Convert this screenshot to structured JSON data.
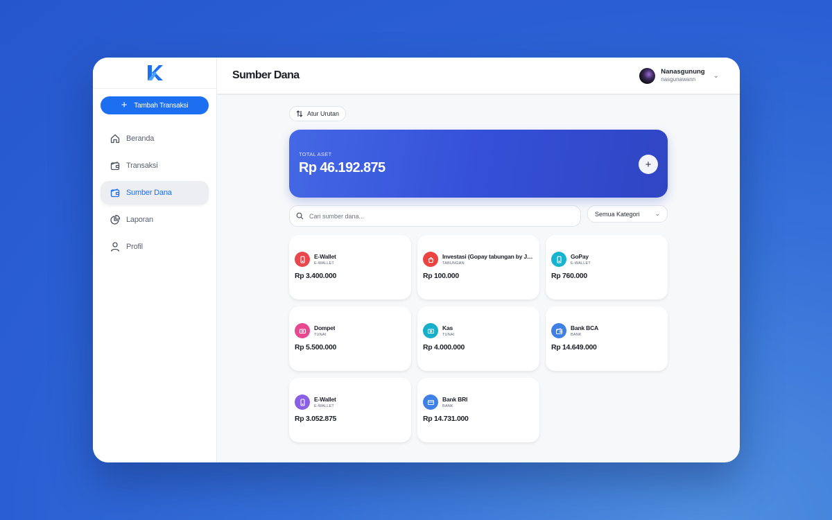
{
  "sidebar": {
    "add_button_label": "Tambah Transaksi",
    "items": [
      {
        "label": "Beranda",
        "icon": "home-icon"
      },
      {
        "label": "Transaksi",
        "icon": "wallet-icon"
      },
      {
        "label": "Sumber Dana",
        "icon": "wallet-icon",
        "active": true
      },
      {
        "label": "Laporan",
        "icon": "pie-chart-icon"
      },
      {
        "label": "Profil",
        "icon": "user-icon"
      }
    ]
  },
  "header": {
    "title": "Sumber Dana",
    "user": {
      "name": "Nanasgunung",
      "handle": "nasgunawann"
    }
  },
  "toolbar": {
    "sort_label": "Atur Urutan"
  },
  "total": {
    "label": "TOTAL ASET",
    "value": "Rp 46.192.875"
  },
  "filters": {
    "search_placeholder": "Cari sumber dana...",
    "category": "Semua Kategori"
  },
  "funds": [
    {
      "name": "E-Wallet",
      "type": "E-WALLET",
      "amount": "Rp 3.400.000",
      "color": "#e9474c",
      "icon": "phone-icon"
    },
    {
      "name": "Investasi (Gopay tabungan by Ja...",
      "type": "TABUNGAN",
      "amount": "Rp 100.000",
      "color": "#ec4343",
      "icon": "piggy-bank-icon"
    },
    {
      "name": "GoPay",
      "type": "E-WALLET",
      "amount": "Rp 760.000",
      "color": "#17b4cf",
      "icon": "phone-icon"
    },
    {
      "name": "Dompet",
      "type": "TUNAI",
      "amount": "Rp 5.500.000",
      "color": "#e8488f",
      "icon": "cash-icon"
    },
    {
      "name": "Kas",
      "type": "TUNAI",
      "amount": "Rp 4.000.000",
      "color": "#16aec8",
      "icon": "cash-icon"
    },
    {
      "name": "Bank BCA",
      "type": "BANK",
      "amount": "Rp 14.649.000",
      "color": "#3f80e6",
      "icon": "wallet-icon"
    },
    {
      "name": "E-Wallet",
      "type": "E-WALLET",
      "amount": "Rp 3.052.875",
      "color": "#8b5ee6",
      "icon": "phone-icon"
    },
    {
      "name": "Bank BRI",
      "type": "BANK",
      "amount": "Rp 14.731.000",
      "color": "#3f80e6",
      "icon": "card-icon"
    }
  ]
}
